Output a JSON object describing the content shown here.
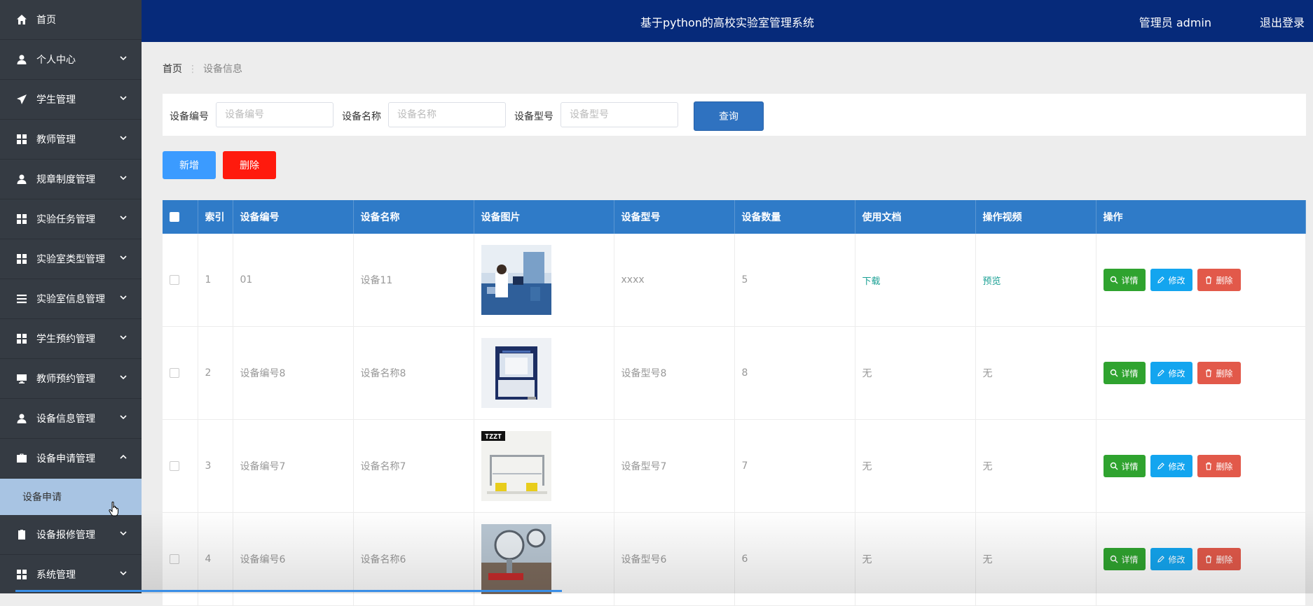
{
  "sidebar": {
    "home": "首页",
    "items": [
      {
        "label": "个人中心"
      },
      {
        "label": "学生管理"
      },
      {
        "label": "教师管理"
      },
      {
        "label": "规章制度管理"
      },
      {
        "label": "实验任务管理"
      },
      {
        "label": "实验室类型管理"
      },
      {
        "label": "实验室信息管理"
      },
      {
        "label": "学生预约管理"
      },
      {
        "label": "教师预约管理"
      },
      {
        "label": "设备信息管理"
      },
      {
        "label": "设备申请管理"
      },
      {
        "label": "设备报修管理"
      },
      {
        "label": "系统管理"
      }
    ],
    "sub_item": "设备申请"
  },
  "header": {
    "title": "基于python的高校实验室管理系统",
    "user": "管理员 admin",
    "logout": "退出登录"
  },
  "breadcrumb": {
    "home": "首页",
    "current": "设备信息"
  },
  "search": {
    "code_label": "设备编号",
    "code_placeholder": "设备编号",
    "name_label": "设备名称",
    "name_placeholder": "设备名称",
    "model_label": "设备型号",
    "model_placeholder": "设备型号",
    "query": "查询"
  },
  "actions": {
    "add": "新增",
    "delete": "删除"
  },
  "table": {
    "headers": [
      "索引",
      "设备编号",
      "设备名称",
      "设备图片",
      "设备型号",
      "设备数量",
      "使用文档",
      "操作视频",
      "操作"
    ],
    "rows": [
      {
        "index": "1",
        "code": "01",
        "name": "设备11",
        "model": "xxxx",
        "qty": "5",
        "doc": "下载",
        "video": "预览"
      },
      {
        "index": "2",
        "code": "设备编号8",
        "name": "设备名称8",
        "model": "设备型号8",
        "qty": "8",
        "doc": "无",
        "video": "无"
      },
      {
        "index": "3",
        "code": "设备编号7",
        "name": "设备名称7",
        "model": "设备型号7",
        "qty": "7",
        "doc": "无",
        "video": "无"
      },
      {
        "index": "4",
        "code": "设备编号6",
        "name": "设备名称6",
        "model": "设备型号6",
        "qty": "6",
        "doc": "无",
        "video": "无"
      }
    ],
    "row_actions": {
      "detail": "详情",
      "edit": "修改",
      "delete": "删除"
    },
    "pic3_text": "TZZT"
  },
  "colors": {
    "topbar": "#062a7a",
    "sidebar": "#353b43",
    "table_header": "#2f7bc8",
    "active_sub": "#a8c4e3"
  }
}
